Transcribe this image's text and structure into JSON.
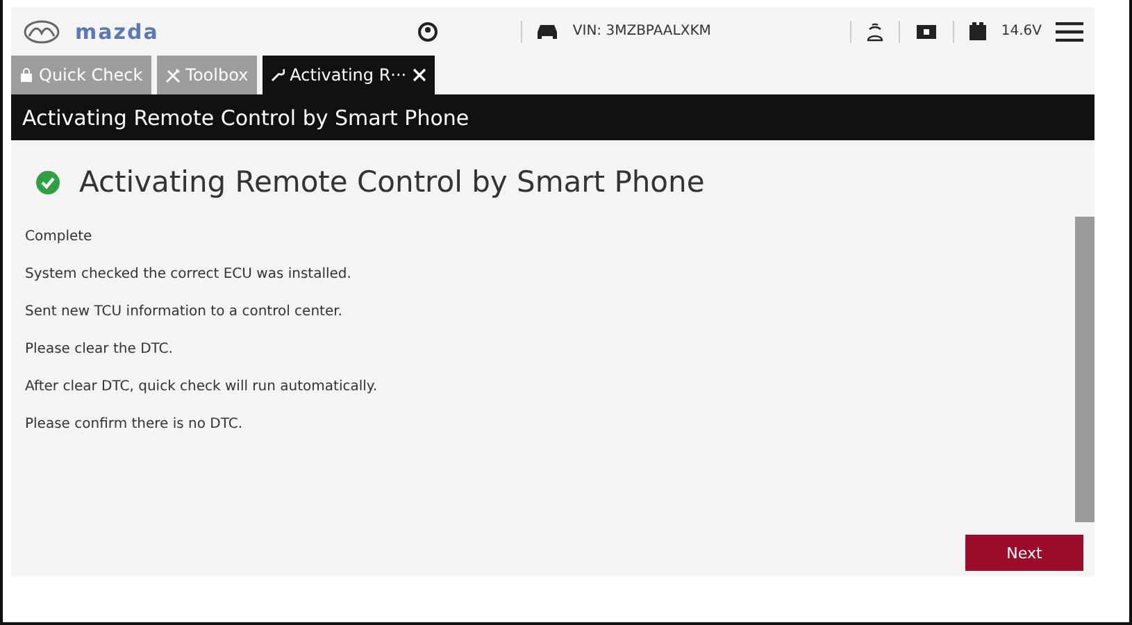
{
  "header": {
    "logo": "mazda",
    "vin": "VIN: 3MZBPAALXKM",
    "voltage": "14.6V"
  },
  "tabs": [
    {
      "label": "Quick Check",
      "kind": "lock",
      "selected": false
    },
    {
      "label": "Toolbox",
      "kind": "tools",
      "selected": false
    },
    {
      "label": "Activating R···",
      "kind": "wrench",
      "selected": true
    }
  ],
  "title_bar": "Activating Remote Control by Smart Phone",
  "heading": {
    "text": "Activating Remote Control by Smart Phone",
    "kind": "success"
  },
  "messages": [
    "Complete",
    "System checked the correct ECU was installed.",
    "Sent new TCU information to a control center.",
    "Please clear the DTC.",
    "After clear DTC, quick check will run automatically.",
    "Please confirm there is no DTC."
  ],
  "buttons": [
    {
      "label": "Next"
    }
  ]
}
